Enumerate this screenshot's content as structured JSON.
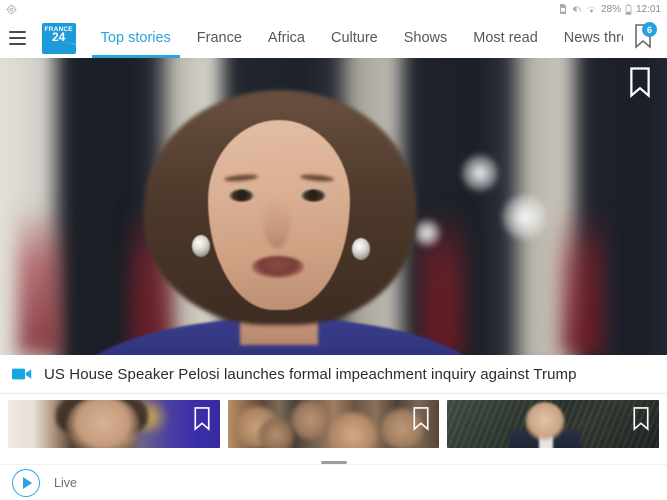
{
  "statusbar": {
    "left_icons": [
      "screenshot-icon"
    ],
    "right_icons": [
      "sim-icon",
      "mute-icon",
      "wifi-icon",
      "battery-icon"
    ],
    "battery_percent": "28%",
    "time": "12:01"
  },
  "nav": {
    "menu_icon": "hamburger-menu-icon",
    "logo_line1": "FRANCE",
    "logo_line2": "24",
    "tabs": [
      {
        "label": "Top stories",
        "active": true
      },
      {
        "label": "France",
        "active": false
      },
      {
        "label": "Africa",
        "active": false
      },
      {
        "label": "Culture",
        "active": false
      },
      {
        "label": "Shows",
        "active": false
      },
      {
        "label": "Most read",
        "active": false
      },
      {
        "label": "News thread",
        "active": false
      }
    ],
    "bookmark_badge": "6"
  },
  "hero": {
    "bookmark_icon": "bookmark-icon",
    "alt": "Nancy Pelosi speaking in front of US flags"
  },
  "headline": {
    "media_icon": "video-camera-icon",
    "text": "US House Speaker Pelosi launches formal impeachment inquiry against Trump"
  },
  "thumbnails": [
    {
      "name": "thumbnail-1",
      "bookmark_icon": "bookmark-icon"
    },
    {
      "name": "thumbnail-2",
      "bookmark_icon": "bookmark-icon"
    },
    {
      "name": "thumbnail-3",
      "bookmark_icon": "bookmark-icon"
    }
  ],
  "bottombar": {
    "play_icon": "play-icon",
    "live_label": "Live"
  },
  "colors": {
    "accent": "#2aa3dd",
    "brand_blue": "#1b9bd8",
    "text_primary": "#2b2b2b",
    "text_secondary": "#57575a",
    "badge": "#2aa3dd",
    "background": "#ffffff"
  }
}
